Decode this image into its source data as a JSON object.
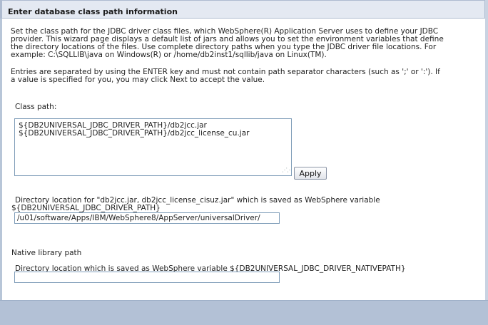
{
  "header": {
    "title": "Enter database class path information"
  },
  "instructions": {
    "paragraph1": [
      "Set the class path for the JDBC driver class files, which WebSphere(R) Application Server uses to define your JDBC",
      "provider. This wizard page displays a default list of jars and allows you to set the environment variables that define",
      "the directory locations of the files. Use complete directory paths when you type the JDBC driver file locations. For",
      "example: C:\\SQLLIB\\java on Windows(R) or /home/db2inst1/sqllib/java on Linux(TM)."
    ],
    "paragraph2": [
      "Entries are separated by using the ENTER key and must not contain path separator characters (such as ';' or ':'). If",
      "a value is specified for you, you may click Next to accept the value."
    ]
  },
  "class_path": {
    "label": "Class path:",
    "lines": [
      "${DB2UNIVERSAL_JDBC_DRIVER_PATH}/db2jcc.jar",
      "${DB2UNIVERSAL_JDBC_DRIVER_PATH}/db2jcc_license_cu.jar"
    ],
    "apply_label": "Apply"
  },
  "directory_location": {
    "label_line1": "Directory location for \"db2jcc.jar, db2jcc_license_cisuz.jar\" which is saved as WebSphere variable",
    "label_line2": "${DB2UNIVERSAL_JDBC_DRIVER_PATH}",
    "value": "/u01/software/Apps/IBM/WebSphere8/AppServer/universalDriver/"
  },
  "native_library": {
    "heading": "Native library path",
    "label": "Directory location which is saved as WebSphere variable ${DB2UNIVERSAL_JDBC_DRIVER_NATIVEPATH}",
    "value": ""
  },
  "colors": {
    "header_bg": "#e4e9f2",
    "footer_bg": "#b3c1d6",
    "field_border": "#7f9db9"
  },
  "icons": {
    "resize_grip": "resize-grip-icon"
  }
}
